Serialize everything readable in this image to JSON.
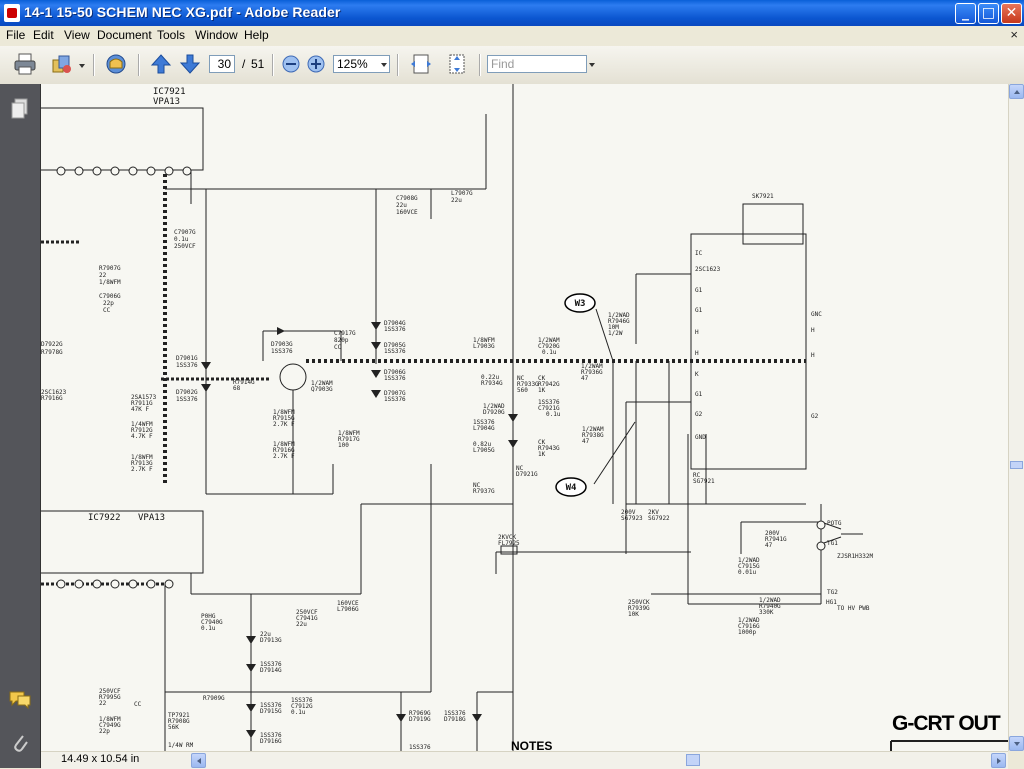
{
  "window": {
    "title": "14-1  15-50 SCHEM NEC XG.pdf - Adobe Reader",
    "controls": {
      "minimize": "_",
      "maximize": "□",
      "close": "✕"
    }
  },
  "menu": {
    "items": [
      "File",
      "Edit",
      "View",
      "Document",
      "Tools",
      "Window",
      "Help"
    ],
    "close": "×"
  },
  "toolbar": {
    "current_page": "30",
    "page_separator": "/",
    "total_pages": "51",
    "zoom": "125%",
    "find_placeholder": "Find",
    "icons": [
      "print-icon",
      "organizer-icon",
      "collaborate-icon",
      "previous-page-icon",
      "next-page-icon",
      "zoom-out-icon",
      "zoom-in-icon",
      "fit-page-icon",
      "fit-width-icon"
    ]
  },
  "leftnav": {
    "icons": [
      "pages-icon",
      "comments-icon",
      "attachments-icon"
    ]
  },
  "document": {
    "ic_top": {
      "ref": "IC7921",
      "part": "VPA13"
    },
    "ic_bottom": {
      "ref": "IC7922",
      "part": "VPA13"
    },
    "wire_labels": [
      "W3",
      "W4"
    ],
    "section_title": "G-CRT OUT",
    "notes_title": "NOTES",
    "connector": "SK7921",
    "labels": [
      "C7907G",
      "0.1u",
      "250VCF",
      "R7907G",
      "22",
      "1/8WFM",
      "C7906G",
      "22p",
      "CC",
      "C7908G",
      "22u",
      "160VCE",
      "L7907G",
      "22u",
      "D7903G",
      "1SS376",
      "C7917G",
      "820p",
      "CC",
      "D7904G",
      "1SS376",
      "D7905G",
      "1SS376",
      "D7906G",
      "1SS376",
      "D7907G",
      "1SS376",
      "D7901G",
      "1SS376",
      "D7902G",
      "1SS376",
      "R7914G",
      "68",
      "1/2WAM",
      "Q7903G",
      "2SA1573",
      "R7911G",
      "47K F",
      "1/4WFM",
      "R7912G",
      "4.7K F",
      "1/8WFM",
      "R7913G",
      "2.7K F",
      "1/8WFM",
      "R7915G",
      "2.7K F",
      "1/8WFM",
      "R7916G",
      "2.7K F",
      "1/8WFM",
      "R7917G",
      "100",
      "1/8WFM",
      "L7903G",
      "0.22u",
      "R7934G",
      "NC",
      "R7933G",
      "560",
      "1/2WAM",
      "C7920G",
      "0.1u",
      "CK",
      "R7942G",
      "1K",
      "1/2WAM",
      "R7936G",
      "47",
      "1/2WAD",
      "D7920G",
      "1SS376",
      "L7904G",
      "0.82u",
      "L7905G",
      "NC",
      "R7937G",
      "NC",
      "D7921G",
      "1SS376",
      "C7921G",
      "0.1u",
      "CK",
      "R7943G",
      "1K",
      "1/2WAM",
      "R7938G",
      "47",
      "1/2WAD",
      "R7946G",
      "10M",
      "1/2W",
      "RC",
      "SG7921",
      "200V",
      "SG7923",
      "2KV",
      "SG7922",
      "200V",
      "R7941G",
      "47",
      "1/2WAD",
      "C7915G",
      "0.01u",
      "250VCK",
      "R7939G",
      "10K",
      "1/2WAD",
      "R7940G",
      "330K",
      "1/2WAD",
      "C7916G",
      "1000p",
      "2KVCK",
      "FL7925",
      "ZJSR1H332M",
      "POTG",
      "TG1",
      "TG2",
      "HG1",
      "TO HV PWB",
      "P0HG",
      "C7940G",
      "0.1u",
      "250VCF",
      "C7941G",
      "22u",
      "160VCE",
      "L7906G",
      "22u",
      "D7913G",
      "1SS376",
      "D7914G",
      "1SS376",
      "D7915G",
      "1SS376",
      "D7916G",
      "1SS376",
      "C7912G",
      "0.1u",
      "250VCF",
      "R7995G",
      "22",
      "1/8WFM",
      "C7949G",
      "22p",
      "CC",
      "TP7921",
      "R7908G",
      "56K",
      "1/4W RM",
      "R7909G",
      "R7969G",
      "D7919G",
      "1SS376",
      "D7918G",
      "1SS376",
      "D7922G",
      "R7978G",
      "2SC1623",
      "R7916G",
      "2SC1623",
      "G1",
      "G1",
      "G2",
      "G2",
      "G1",
      "H",
      "H",
      "K",
      "GND",
      "IC",
      "GNC",
      "H",
      "H",
      "K"
    ]
  },
  "status": {
    "page_size": "14.49 x 10.54 in"
  }
}
